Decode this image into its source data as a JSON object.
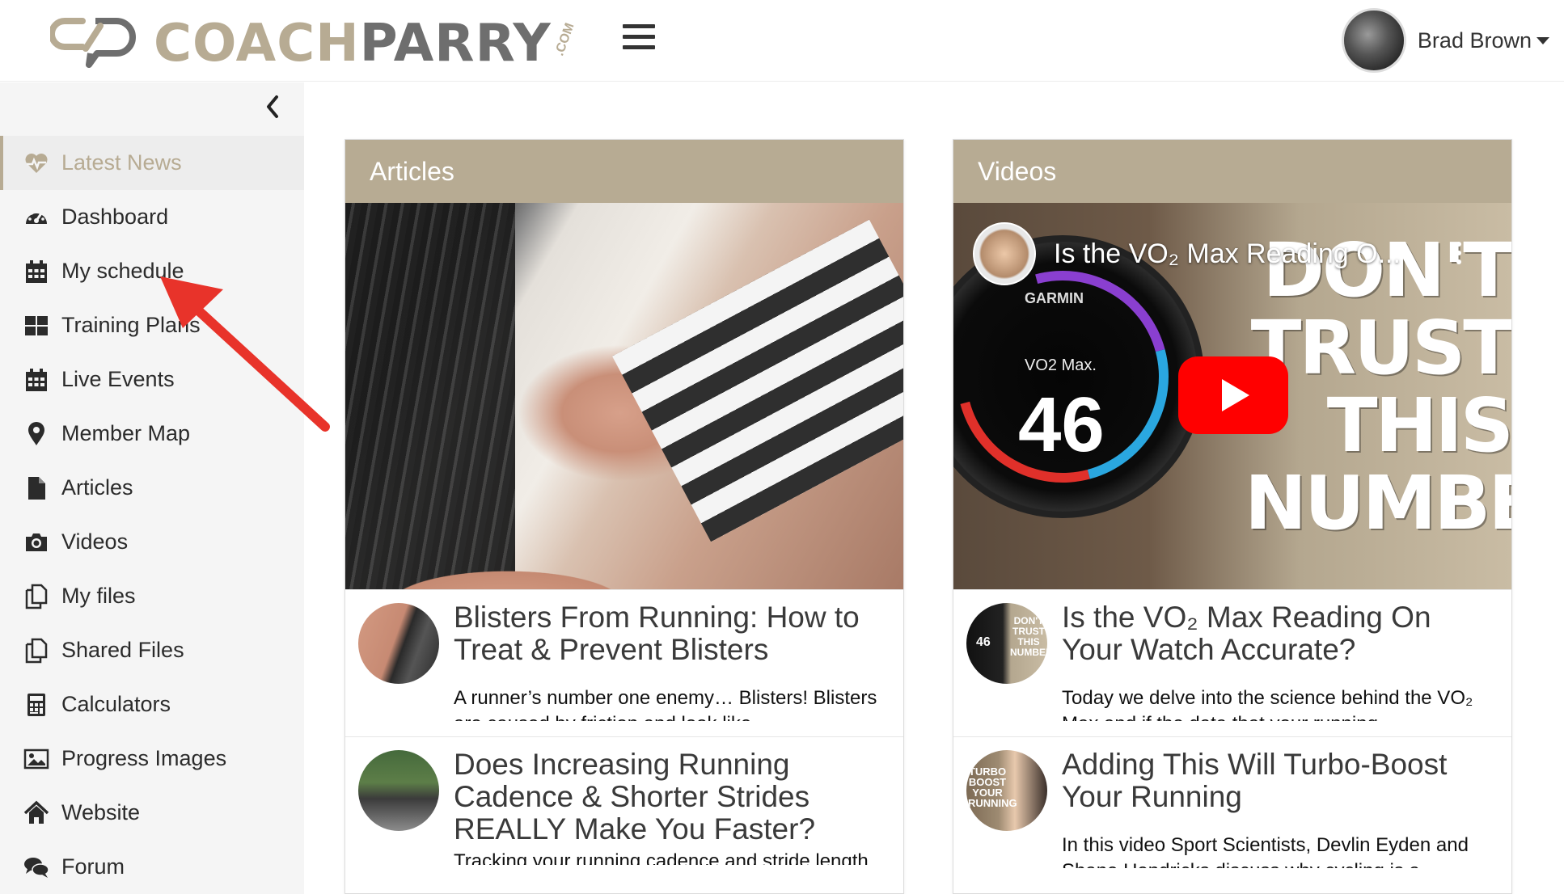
{
  "brand": {
    "name_part1": "COACH",
    "name_part2": "PARRY",
    "suffix": ".COM",
    "accent": "#b7ab93",
    "dark": "#6e6e6e"
  },
  "user": {
    "name": "Brad Brown"
  },
  "sidebar": {
    "items": [
      {
        "label": "Latest News",
        "icon": "heartbeat-icon",
        "active": true
      },
      {
        "label": "Dashboard",
        "icon": "dashboard-gauge-icon"
      },
      {
        "label": "My schedule",
        "icon": "calendar-icon"
      },
      {
        "label": "Training Plans",
        "icon": "grid-icon"
      },
      {
        "label": "Live Events",
        "icon": "calendar-icon"
      },
      {
        "label": "Member Map",
        "icon": "map-pin-icon"
      },
      {
        "label": "Articles",
        "icon": "file-icon"
      },
      {
        "label": "Videos",
        "icon": "camera-icon"
      },
      {
        "label": "My files",
        "icon": "copy-files-icon"
      },
      {
        "label": "Shared Files",
        "icon": "copy-files-icon"
      },
      {
        "label": "Calculators",
        "icon": "calculator-icon"
      },
      {
        "label": "Progress Images",
        "icon": "image-icon"
      },
      {
        "label": "Website",
        "icon": "home-icon"
      },
      {
        "label": "Forum",
        "icon": "chat-icon"
      }
    ]
  },
  "articles": {
    "title": "Articles",
    "items": [
      {
        "title": "Blisters From Running: How to Treat & Prevent Blisters",
        "excerpt": "A runner’s number one enemy… Blisters! Blisters are caused by friction and look like"
      },
      {
        "title": "Does Increasing Running Cadence & Shorter Strides REALLY Make You Faster?",
        "excerpt": "Tracking your running cadence and stride length"
      }
    ]
  },
  "videos": {
    "title": "Videos",
    "hero": {
      "video_title": "Is the VO₂ Max Reading O...",
      "watch_brand": "GARMIN",
      "watch_label": "VO2 Max.",
      "watch_value": "46",
      "overlay_line1": "DON'T",
      "overlay_line2": "TRUST",
      "overlay_line3": "THIS",
      "overlay_line4": "NUMBER"
    },
    "items": [
      {
        "title": "Is the VO₂ Max Reading On Your Watch Accurate?",
        "excerpt": "Today we delve into the science behind the VO₂ Max and if the data that your running",
        "thumb_text": "DON'T TRUST THIS NUMBER",
        "thumb_value": "46"
      },
      {
        "title": "Adding This Will Turbo-Boost Your Running",
        "excerpt": "In this video Sport Scientists, Devlin Eyden and Shane Hendricks discuss why cycling is a",
        "thumb_text": "TURBO BOOST YOUR RUNNING"
      }
    ]
  }
}
